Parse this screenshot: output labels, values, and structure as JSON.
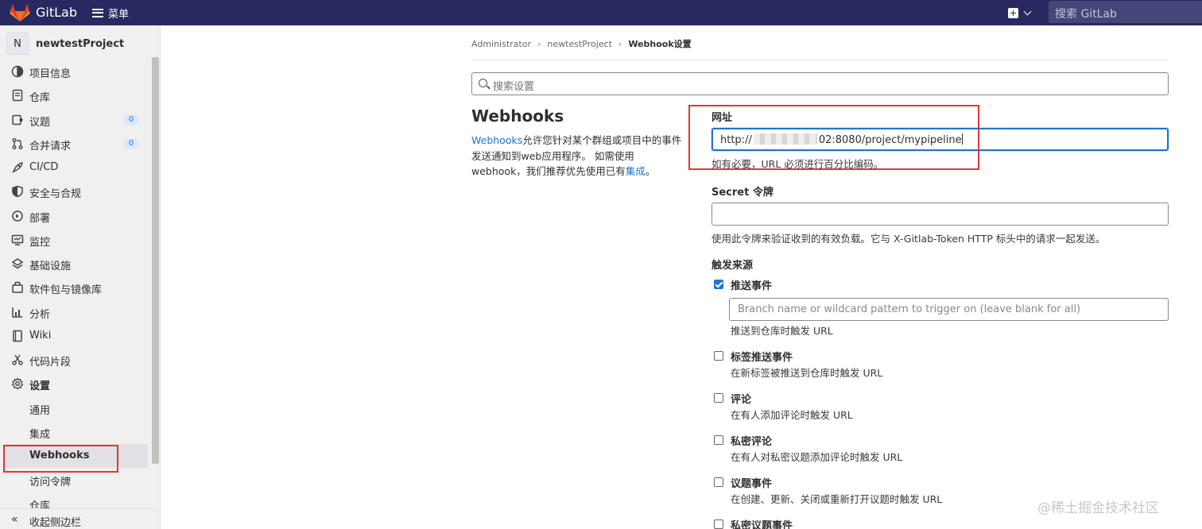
{
  "topbar": {
    "brand": "GitLab",
    "menu_label": "菜单",
    "search_placeholder": "搜索 GitLab"
  },
  "sidebar": {
    "project_initial": "N",
    "project_name": "newtestProject",
    "items": [
      {
        "label": "项目信息",
        "icon": "info-icon"
      },
      {
        "label": "仓库",
        "icon": "document-icon"
      },
      {
        "label": "议题",
        "icon": "issues-icon",
        "count": "0"
      },
      {
        "label": "合并请求",
        "icon": "merge-request-icon",
        "count": "0"
      },
      {
        "label": "CI/CD",
        "icon": "rocket-icon"
      },
      {
        "label": "安全与合规",
        "icon": "shield-icon"
      },
      {
        "label": "部署",
        "icon": "deployments-icon"
      },
      {
        "label": "监控",
        "icon": "monitor-icon"
      },
      {
        "label": "基础设施",
        "icon": "cloud-icon"
      },
      {
        "label": "软件包与镜像库",
        "icon": "package-icon"
      },
      {
        "label": "分析",
        "icon": "chart-icon"
      },
      {
        "label": "Wiki",
        "icon": "book-icon"
      },
      {
        "label": "代码片段",
        "icon": "scissors-icon"
      },
      {
        "label": "设置",
        "icon": "gear-icon"
      }
    ],
    "settings_sub": [
      "通用",
      "集成",
      "Webhooks",
      "访问令牌",
      "仓库"
    ],
    "collapse_label": "收起侧边栏"
  },
  "breadcrumb": [
    "Administrator",
    "newtestProject",
    "Webhook设置"
  ],
  "search_settings_placeholder": "搜索设置",
  "webhooks": {
    "title": "Webhooks",
    "desc_link": "Webhooks",
    "desc_text": "允许您针对某个群组或项目中的事件发送通知到web应用程序。 如需使用webhook，我们推荐优先使用已有",
    "desc_link2": "集成",
    "desc_end": "。"
  },
  "form": {
    "url_label": "网址",
    "url_prefix": "http://",
    "url_suffix": "02:8080/project/mypipeline",
    "url_help": "如有必要，URL 必须进行百分比编码。",
    "secret_label": "Secret 令牌",
    "secret_help": "使用此令牌来验证收到的有效负载。它与 X-Gitlab-Token HTTP 标头中的请求一起发送。",
    "trigger_label": "触发来源",
    "push_title": "推送事件",
    "branch_placeholder": "Branch name or wildcard pattern to trigger on (leave blank for all)",
    "push_help": "推送到仓库时触发 URL",
    "events": [
      {
        "title": "标签推送事件",
        "help": "在新标签被推送到仓库时触发 URL"
      },
      {
        "title": "评论",
        "help": "在有人添加评论时触发 URL"
      },
      {
        "title": "私密评论",
        "help": "在有人对私密议题添加评论时触发 URL"
      },
      {
        "title": "议题事件",
        "help": "在创建、更新、关闭或重新打开议题时触发 URL"
      },
      {
        "title": "私密议题事件",
        "help": ""
      }
    ]
  },
  "watermark": "@稀土掘金技术社区",
  "colors": {
    "topbar": "#292961",
    "accent": "#1f75cb",
    "highlight": "#e23535"
  }
}
